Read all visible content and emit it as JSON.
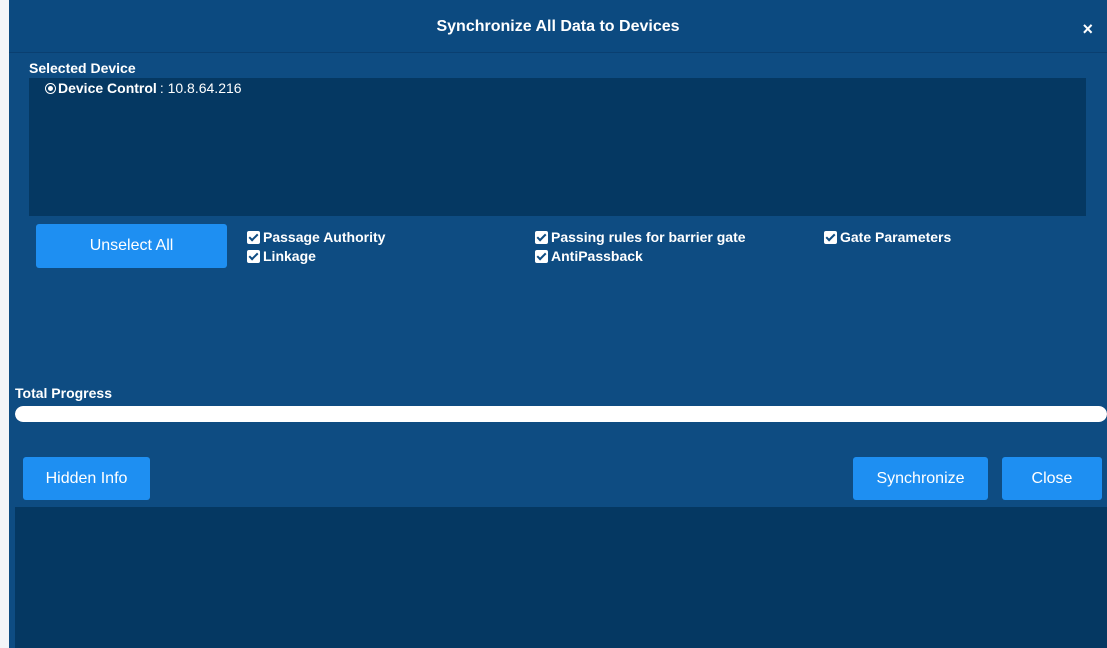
{
  "dialog": {
    "title": "Synchronize All Data to Devices",
    "close_icon": "×"
  },
  "selected_device": {
    "label": "Selected Device",
    "device_name": "Device Control",
    "device_address": ": 10.8.64.216"
  },
  "buttons": {
    "unselect_all": "Unselect All",
    "hidden_info": "Hidden Info",
    "synchronize": "Synchronize",
    "close": "Close"
  },
  "options": [
    {
      "label": "Passage Authority",
      "checked": true
    },
    {
      "label": "Linkage",
      "checked": true
    },
    {
      "label": "Passing rules for barrier gate",
      "checked": true
    },
    {
      "label": "AntiPassback",
      "checked": true
    },
    {
      "label": "Gate Parameters",
      "checked": true
    }
  ],
  "progress": {
    "label": "Total Progress",
    "value": 1.0
  },
  "colors": {
    "dialog_bg": "#0e4c82",
    "panel_bg": "#053862",
    "button": "#1e8ff2"
  }
}
